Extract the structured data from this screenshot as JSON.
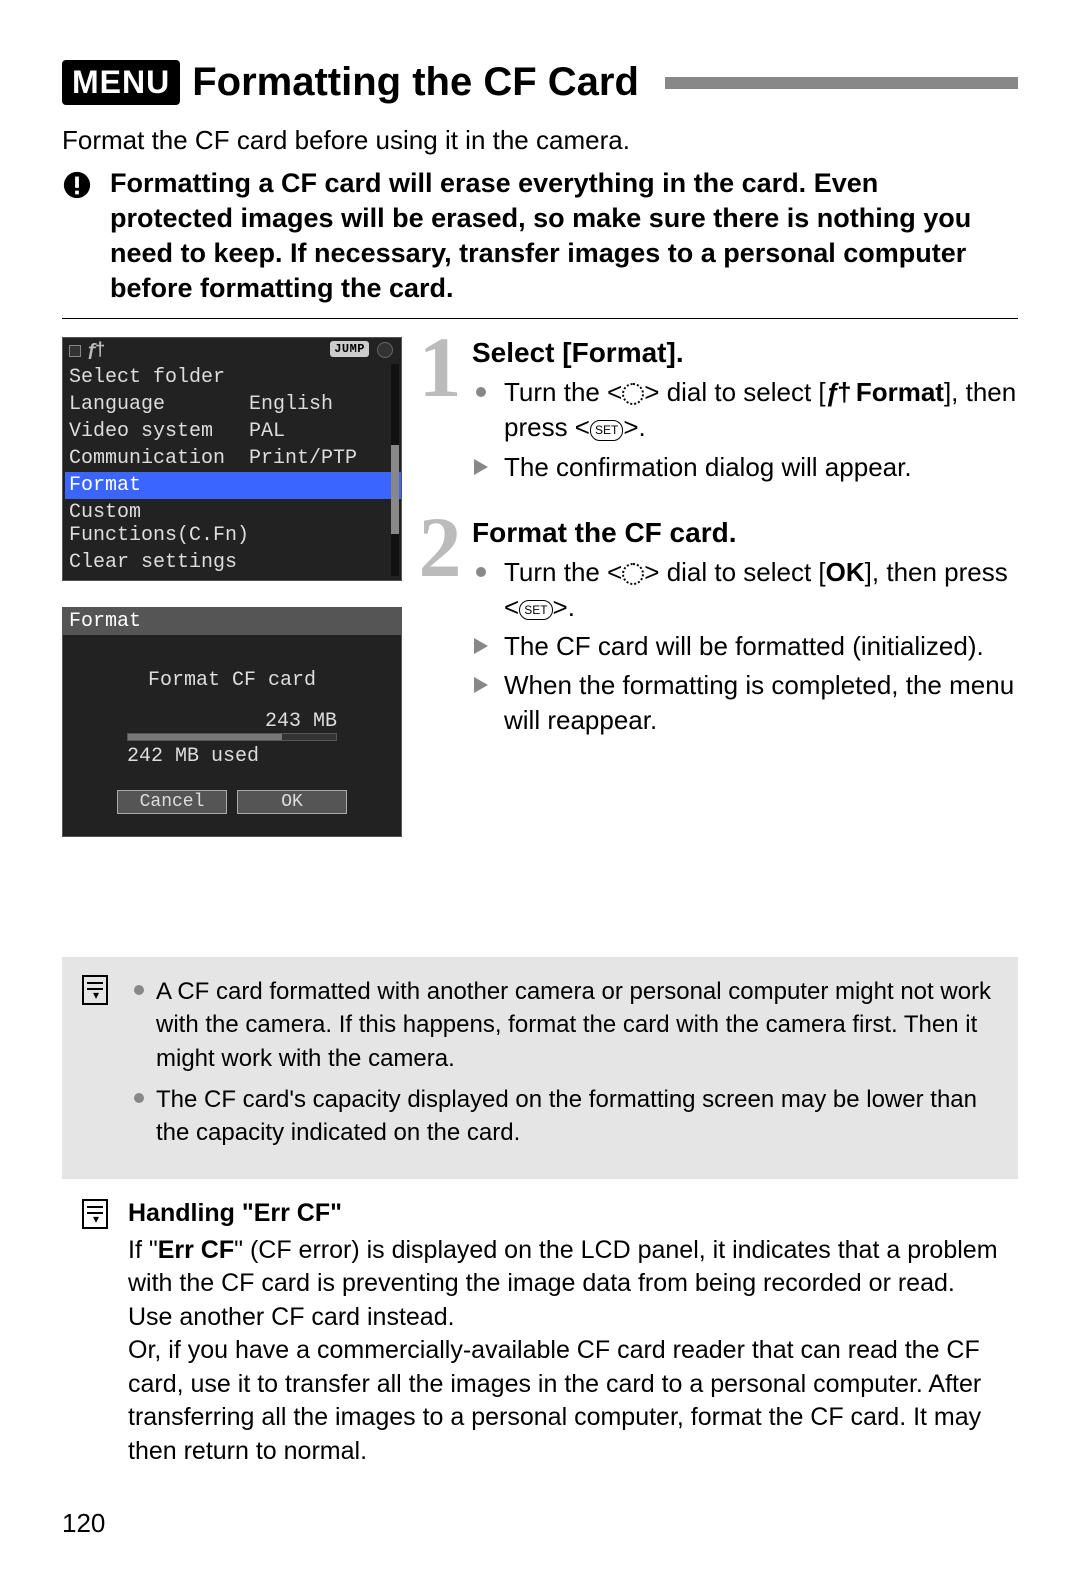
{
  "title": {
    "menu_badge": "MENU",
    "heading": "Formatting the CF Card"
  },
  "intro": "Format the CF card before using it in the camera.",
  "warning": "Formatting a CF card will erase everything in the card. Even protected images will be erased, so make sure there is nothing you need to keep. If necessary, transfer images to a personal computer before formatting the card.",
  "lcd1": {
    "jump": "JUMP",
    "items": [
      {
        "label": "Select folder",
        "value": ""
      },
      {
        "label": "Language",
        "value": "English"
      },
      {
        "label": "Video system",
        "value": "PAL"
      },
      {
        "label": "Communication",
        "value": "Print/PTP"
      },
      {
        "label": "Format",
        "value": "",
        "selected": true
      },
      {
        "label": "Custom Functions(C.Fn)",
        "value": ""
      },
      {
        "label": "Clear settings",
        "value": ""
      }
    ]
  },
  "lcd2": {
    "title": "Format",
    "line1": "Format CF card",
    "total": "243 MB",
    "used": "242 MB used",
    "cancel": "Cancel",
    "ok": "OK"
  },
  "steps": [
    {
      "num": "1",
      "title": "Select [Format].",
      "bullets": [
        {
          "type": "bullet",
          "pre": "Turn the <",
          "mid": "> dial to select [",
          "bold": "Format",
          "post": "], then press <",
          "tail": ">.",
          "icons": [
            "dial",
            "tool",
            "set"
          ]
        },
        {
          "type": "tri",
          "text": "The confirmation dialog will appear."
        }
      ]
    },
    {
      "num": "2",
      "title": "Format the CF card.",
      "bullets": [
        {
          "type": "bullet",
          "pre": "Turn the <",
          "mid": "> dial to select [",
          "bold": "OK",
          "post": "], then press <",
          "tail": ">.",
          "icons": [
            "dial",
            "set"
          ]
        },
        {
          "type": "tri",
          "text": "The CF card will be formatted (initialized)."
        },
        {
          "type": "tri",
          "text": "When the formatting is completed, the menu will reappear."
        }
      ]
    }
  ],
  "notes": [
    "A CF card formatted with another camera or personal computer might not work with the camera. If this happens, format the card with the camera first. Then it might work with the camera.",
    "The CF card's capacity displayed on the formatting screen may be lower than the capacity indicated on the card."
  ],
  "err": {
    "title": "Handling \"Err CF\"",
    "body_pre": "If \"",
    "body_bold": "Err CF",
    "body_post": "\" (CF error) is displayed on the LCD panel, it indicates that a problem with the CF card is preventing the image data from being recorded or read. Use another CF card instead.",
    "body2": "Or, if you have a commercially-available CF card reader that can read the CF card, use it to transfer all the images in the card to a personal computer. After transferring all the images to a personal computer, format the CF card. It may then return to normal."
  },
  "page_number": "120"
}
